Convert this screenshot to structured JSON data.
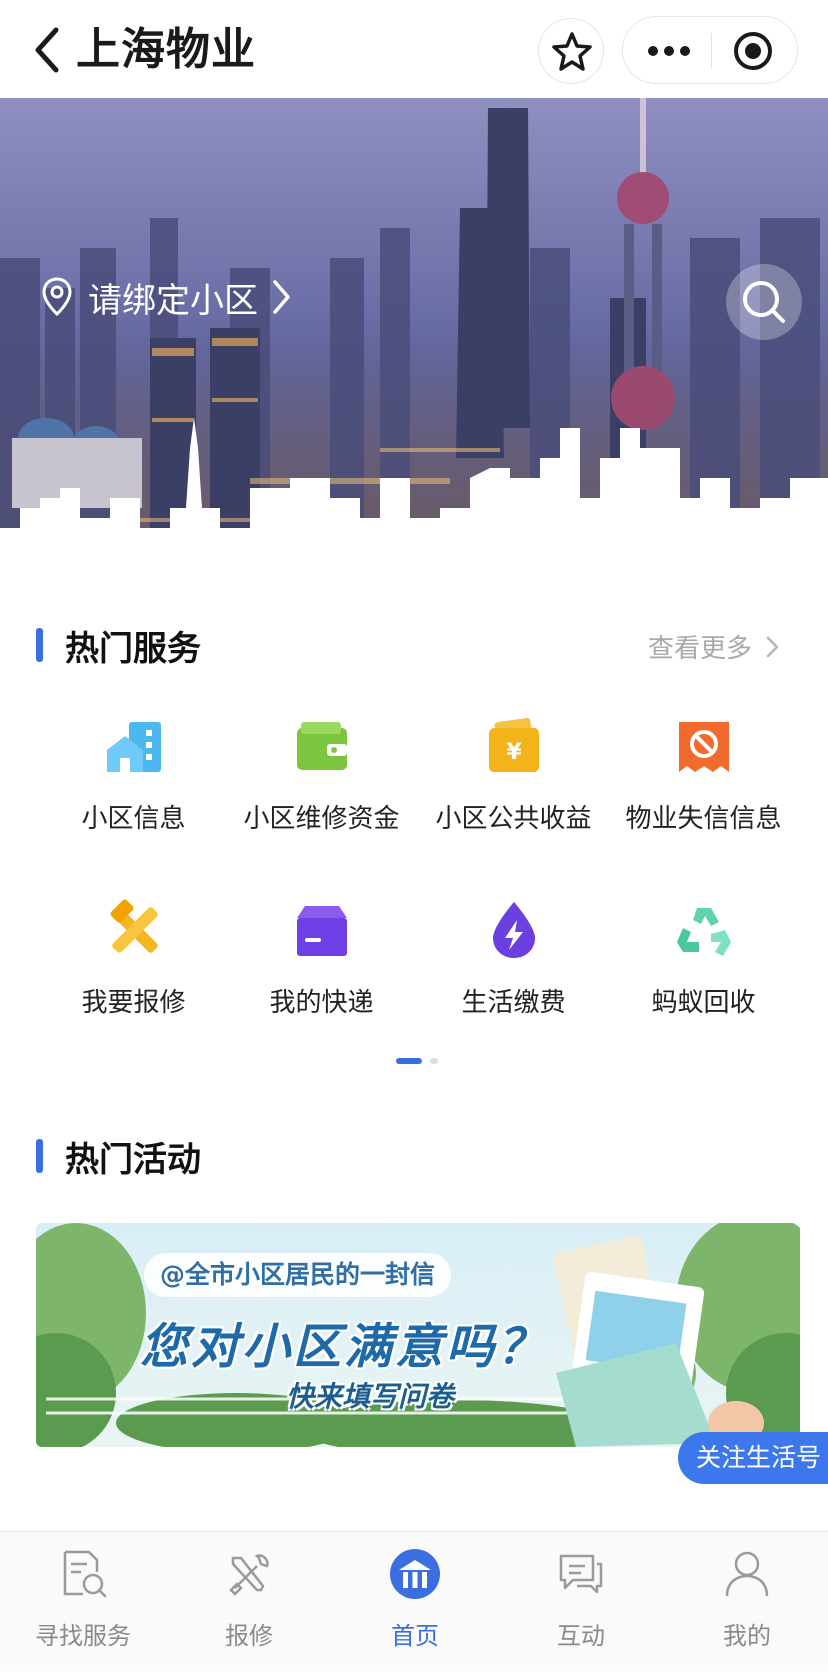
{
  "header": {
    "title": "上海物业"
  },
  "hero": {
    "location_label": "请绑定小区"
  },
  "hot_services": {
    "title": "热门服务",
    "see_more": "查看更多",
    "items": [
      {
        "label": "小区信息",
        "icon": "building-icon"
      },
      {
        "label": "小区维修资金",
        "icon": "wallet-icon"
      },
      {
        "label": "小区公共收益",
        "icon": "yuan-wallet-icon"
      },
      {
        "label": "物业失信信息",
        "icon": "prohibited-ticket-icon"
      },
      {
        "label": "我要报修",
        "icon": "repair-tools-icon"
      },
      {
        "label": "我的快递",
        "icon": "package-icon"
      },
      {
        "label": "生活缴费",
        "icon": "lightning-drop-icon"
      },
      {
        "label": "蚂蚁回收",
        "icon": "recycle-icon"
      }
    ]
  },
  "hot_activities": {
    "title": "热门活动",
    "banner": {
      "line1": "@全市小区居民的一封信",
      "line2": "您对小区满意吗？",
      "line3": "快来填写问卷"
    }
  },
  "follow_button": "关注生活号",
  "tabbar": {
    "items": [
      {
        "label": "寻找服务",
        "icon": "search-doc-icon"
      },
      {
        "label": "报修",
        "icon": "tools-icon"
      },
      {
        "label": "首页",
        "icon": "home-icon",
        "active": true
      },
      {
        "label": "互动",
        "icon": "chat-icon"
      },
      {
        "label": "我的",
        "icon": "user-icon"
      }
    ]
  },
  "colors": {
    "accent": "#3b6fe0",
    "follow_bg": "#3c78ec"
  }
}
